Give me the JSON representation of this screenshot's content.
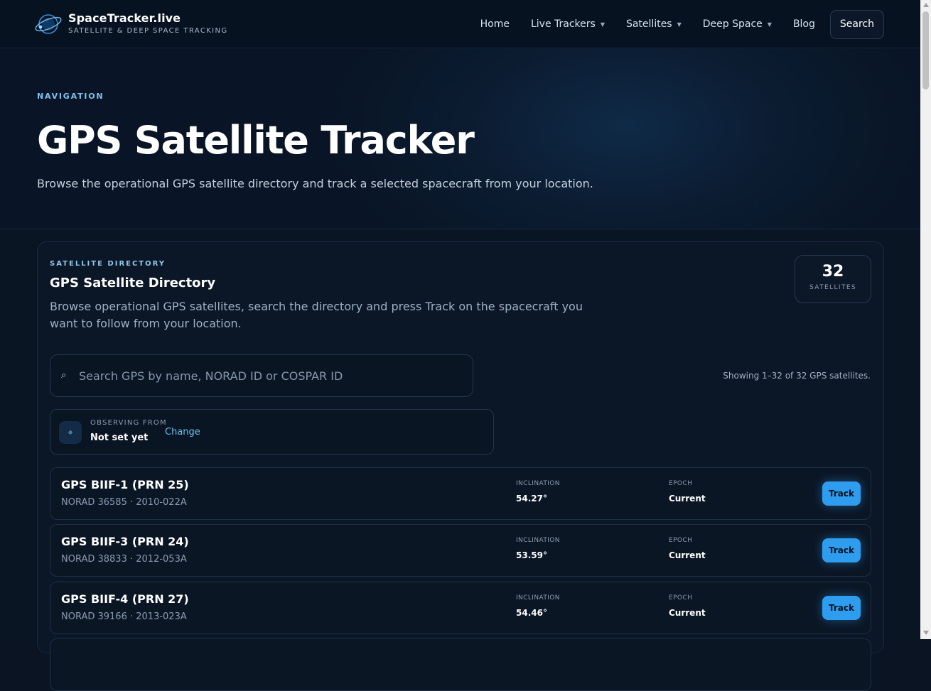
{
  "brand": {
    "name": "SpaceTracker.live",
    "tagline": "SATELLITE & DEEP SPACE TRACKING",
    "logo_icon": "orbit-planet-icon"
  },
  "nav": {
    "items": [
      {
        "label": "Home",
        "dropdown": false
      },
      {
        "label": "Live Trackers",
        "dropdown": true
      },
      {
        "label": "Satellites",
        "dropdown": true
      },
      {
        "label": "Deep Space",
        "dropdown": true
      },
      {
        "label": "Blog",
        "dropdown": false
      }
    ],
    "search_label": "Search"
  },
  "hero": {
    "eyebrow": "NAVIGATION",
    "title": "GPS Satellite Tracker",
    "subtitle": "Browse the operational GPS satellite directory and track a selected spacecraft from your location."
  },
  "directory": {
    "eyebrow": "SATELLITE DIRECTORY",
    "title": "GPS Satellite Directory",
    "description": "Browse operational GPS satellites, search the directory and press Track on the spacecraft you want to follow from your location.",
    "count": "32",
    "count_label": "SATELLITES",
    "search_placeholder": "Search GPS by name, NORAD ID or COSPAR ID",
    "showing": "Showing 1–32 of 32 GPS satellites.",
    "observer": {
      "label": "OBSERVING FROM",
      "value": "Not set yet",
      "change_label": "Change"
    },
    "stat_labels": {
      "inclination": "INCLINATION",
      "epoch": "EPOCH"
    },
    "track_label": "Track",
    "satellites": [
      {
        "name": "GPS BIIF-1 (PRN 25)",
        "meta": "NORAD 36585 · 2010-022A",
        "inclination": "54.27°",
        "epoch": "Current"
      },
      {
        "name": "GPS BIIF-3 (PRN 24)",
        "meta": "NORAD 38833 · 2012-053A",
        "inclination": "53.59°",
        "epoch": "Current"
      },
      {
        "name": "GPS BIIF-4 (PRN 27)",
        "meta": "NORAD 39166 · 2013-023A",
        "inclination": "54.46°",
        "epoch": "Current"
      }
    ]
  },
  "colors": {
    "accent": "#2e9df0",
    "background": "#0a1422",
    "eyebrow": "#7fc3ef"
  }
}
